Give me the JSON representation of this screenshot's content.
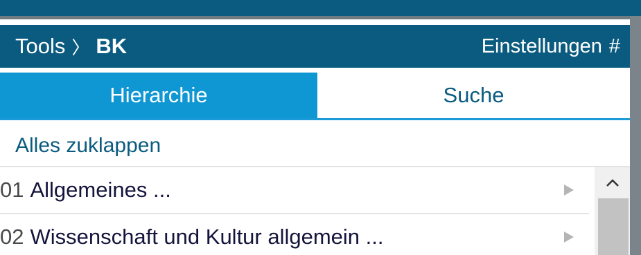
{
  "breadcrumb": {
    "root": "Tools",
    "separator": "〉",
    "current": "BK"
  },
  "header": {
    "settings_label": "Einstellungen",
    "hash_symbol": "#"
  },
  "tabs": [
    {
      "label": "Hierarchie",
      "active": true
    },
    {
      "label": "Suche",
      "active": false
    }
  ],
  "actions": {
    "collapse_all": "Alles zuklappen"
  },
  "list": {
    "items": [
      {
        "code": "01",
        "title": "Allgemeines ..."
      },
      {
        "code": "02",
        "title": "Wissenschaft und Kultur allgemein ..."
      }
    ]
  },
  "colors": {
    "header_bg": "#0a5b7f",
    "active_tab_bg": "#0e97d2",
    "accent_line": "#1a9ad6",
    "link_text": "#0a5b7f"
  },
  "icons": {
    "expand": "triangle-right-icon",
    "scroll_up": "chevron-up-icon"
  }
}
